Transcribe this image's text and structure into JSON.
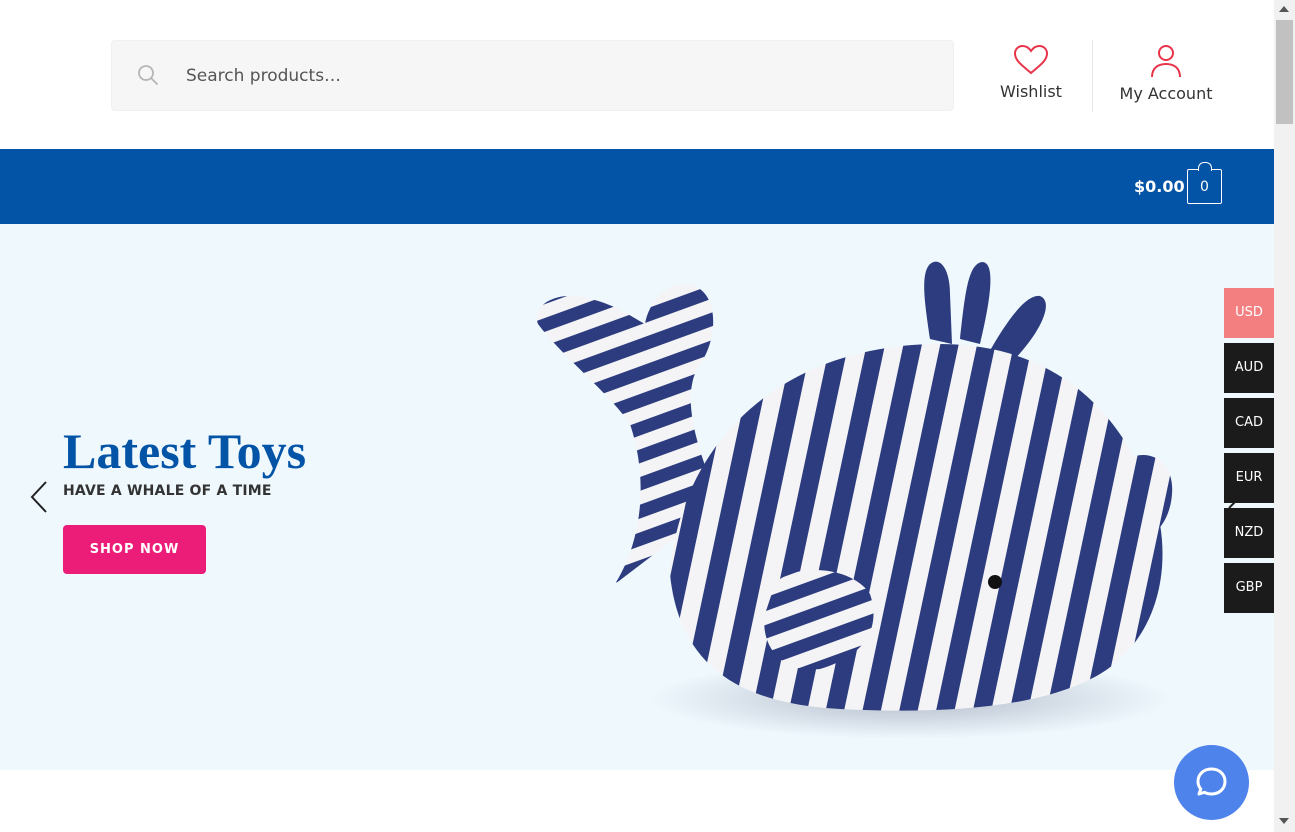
{
  "header": {
    "search": {
      "placeholder": "Search products…",
      "icon": "search-icon"
    },
    "wishlist": {
      "label": "Wishlist",
      "icon": "heart-icon"
    },
    "account": {
      "label": "My Account",
      "icon": "user-icon"
    }
  },
  "navbar": {
    "cart_total": "$0.00",
    "cart_count": "0",
    "cart_icon": "shopping-bag-icon"
  },
  "hero": {
    "title": "Latest Toys",
    "subtitle": "HAVE A WHALE OF A TIME",
    "button_label": "SHOP NOW",
    "prev_icon": "chevron-left-icon",
    "next_icon": "chevron-right-icon"
  },
  "currencies": [
    {
      "code": "USD",
      "active": true
    },
    {
      "code": "AUD",
      "active": false
    },
    {
      "code": "CAD",
      "active": false
    },
    {
      "code": "EUR",
      "active": false
    },
    {
      "code": "NZD",
      "active": false
    },
    {
      "code": "GBP",
      "active": false
    }
  ],
  "chat": {
    "icon": "chat-bubble-icon"
  },
  "colors": {
    "brand_blue": "#0353a6",
    "accent_pink": "#ec1d79",
    "wishlist_red": "#e8334a",
    "currency_active": "#f37f80",
    "currency_inactive": "#1b1b1b",
    "chat_blue": "#4f83ec",
    "hero_bg": "#eff8fd"
  }
}
